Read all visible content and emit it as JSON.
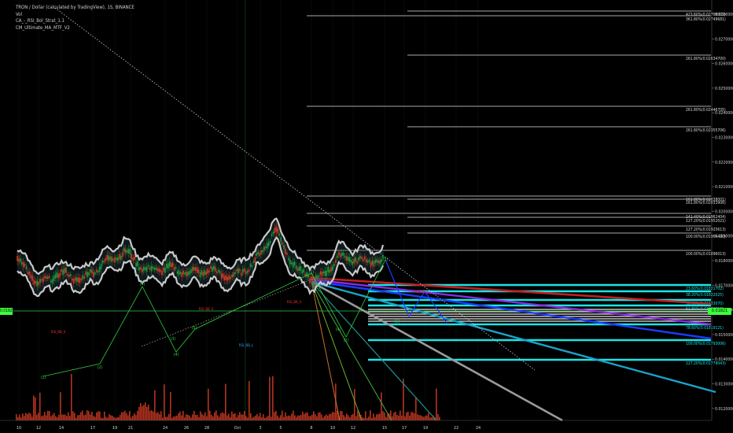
{
  "legend": {
    "title": "TRON / Dollar (calculated by TradingView), 1S, BINANCE",
    "indicators": [
      "Vol",
      "CA_-_RSI_Bol_Strat_1.1",
      "CM_Ultimate_MA_MTF_V2"
    ]
  },
  "price_axis": {
    "ticks": [
      "0.02800000",
      "0.02700000",
      "0.02600000",
      "0.02500000",
      "0.02400000",
      "0.02300000",
      "0.02200000",
      "0.02100000",
      "0.02000000",
      "0.01900000",
      "0.01800000",
      "0.01700000",
      "0.01600000",
      "0.01500000",
      "0.01400000",
      "0.01300000",
      "0.01200000"
    ]
  },
  "time_axis": {
    "ticks": [
      "10",
      "12",
      "14",
      "17",
      "19",
      "21",
      "24",
      "26",
      "28",
      "Oct",
      "3",
      "5",
      "8",
      "10",
      "12",
      "15",
      "17",
      "19",
      "22",
      "24"
    ]
  },
  "current_price": {
    "label": "0.01821",
    "left_label": "0.01821"
  },
  "fib_labels": [
    "423.60%(0.02758072)",
    "361.80%(0.02749681)",
    "261.80%(0.02634700)",
    "261.80%(0.02446705)",
    "261.80%(0.02355706)",
    "161.80%(0.02038001)",
    "161.80%(0.02033906)",
    "141.40%(0.01962404)",
    "127.20%(0.01952021)",
    "127.20%(0.01925613)",
    "100.00%(0.01904490)",
    "100.00%(0.01896013)",
    "23.60%(0.01821702)",
    "38.20%(0.01822025)",
    "50.00%(0.01833070)",
    "61.80%(0.01820813)",
    "78.60%(0.01810121)",
    "100.00%(0.01793006)",
    "127.20%(0.01779043)"
  ],
  "wave_labels": [
    "(1)",
    "(2)",
    "(3)",
    "(4)",
    "(5)",
    "(1)",
    "(2)",
    "(5)",
    "(3)",
    "(4)",
    "(5)"
  ],
  "signal_labels": [
    "RSI_BB_S",
    "RSI_BB_S",
    "RSI_BB_S",
    "RSI_BB_L",
    "RSI_BB_S"
  ],
  "colors": {
    "background": "#000000",
    "candles": "#d23c24",
    "bollinger": "#c8c8c8",
    "fib_white": "#e0e0e0",
    "fib_cyan": "#19e6e6",
    "fan_red": "#c02020",
    "fan_purple": "#8a2be2",
    "fan_blue": "#1a3cff",
    "fan_gray": "#9a9a9a",
    "fan_teal": "#1aa3c9",
    "wave_green": "#2ecc40",
    "price_tag": "#3cff3c"
  },
  "chart_data": {
    "type": "line",
    "title": "TRON / Dollar (calculated by TradingView), 1S, BINANCE",
    "xlabel": "",
    "ylabel": "",
    "ylim": [
      0.0115,
      0.0285
    ],
    "x": [
      "10",
      "12",
      "14",
      "17",
      "19",
      "21",
      "24",
      "26",
      "28",
      "Oct",
      "3",
      "5",
      "8",
      "10",
      "12",
      "15",
      "17",
      "19"
    ],
    "series": [
      {
        "values": [
          0.0183,
          0.0172,
          0.0177,
          0.0174,
          0.0181,
          0.0186,
          0.0178,
          0.0179,
          0.0177,
          0.0178,
          0.0175,
          0.0181,
          0.0195,
          0.0178,
          0.0174,
          0.0184,
          0.0182,
          0.0182
        ]
      }
    ]
  }
}
